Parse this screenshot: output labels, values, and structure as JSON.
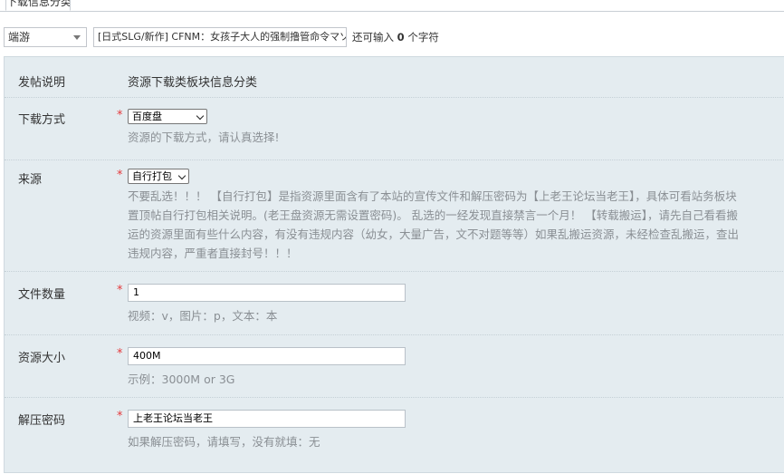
{
  "tab": {
    "label": "下载信息分类"
  },
  "topbar": {
    "category_value": "端游",
    "title_value": "[日式SLG/新作] CFNM：女孩子大人的强制撸管命令マゾ",
    "count_prefix": "还可输入",
    "count_value": "0",
    "count_suffix": "个字符"
  },
  "form": {
    "intro": {
      "label": "发帖说明",
      "value": "资源下载类板块信息分类"
    },
    "download_method": {
      "label": "下载方式",
      "required": "*",
      "selected": "百度盘",
      "hint": "资源的下载方式，请认真选择!"
    },
    "source": {
      "label": "来源",
      "required": "*",
      "selected": "自行打包",
      "desc_lines": [
        "不要乱选！！！ 【自行打包】是指资源里面含有了本站的宣传文件和解压密码为【上老王论坛当老王】，具体可看站务板块",
        "置顶帖自行打包相关说明。(老王盘资源无需设置密码)。 乱选的一经发现直接禁言一个月！ 【转载搬运】，请先自己看看搬",
        "运的资源里面有些什么内容，有没有违规内容（幼女，大量广告，文不对题等等）如果乱搬运资源，未经检查乱搬运，查出",
        "违规内容，严重者直接封号！！！"
      ]
    },
    "file_count": {
      "label": "文件数量",
      "required": "*",
      "value": "1",
      "hint": "视频：v，图片：p，文本：本"
    },
    "size": {
      "label": "资源大小",
      "required": "*",
      "value": "400M",
      "hint": "示例：3000M or 3G"
    },
    "password": {
      "label": "解压密码",
      "required": "*",
      "value": "上老王论坛当老王",
      "hint": "如果解压密码，请填写，没有就填：无"
    }
  }
}
